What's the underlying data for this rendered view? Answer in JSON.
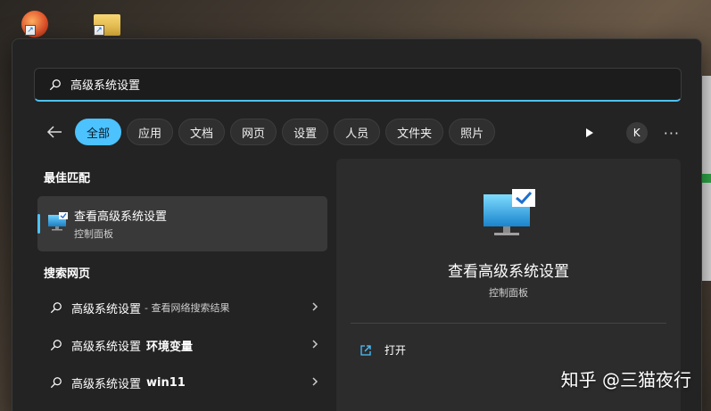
{
  "search": {
    "query": "高级系统设置"
  },
  "filters": {
    "tabs": [
      "全部",
      "应用",
      "文档",
      "网页",
      "设置",
      "人员",
      "文件夹",
      "照片"
    ],
    "avatar_letter": "K",
    "more": "···"
  },
  "best_match": {
    "heading": "最佳匹配",
    "title": "查看高级系统设置",
    "subtitle": "控制面板"
  },
  "web_search": {
    "heading": "搜索网页",
    "items": [
      {
        "main": "高级系统设置",
        "sub": "- 查看网络搜索结果",
        "bold": ""
      },
      {
        "main": "高级系统设置",
        "sub": "",
        "bold": "环境变量"
      },
      {
        "main": "高级系统设置",
        "sub": "",
        "bold": "win11"
      }
    ]
  },
  "preview": {
    "title": "查看高级系统设置",
    "subtitle": "控制面板",
    "open_label": "打开"
  },
  "watermark": "知乎 @三猫夜行",
  "colors": {
    "accent": "#4cc2ff",
    "panel": "#232323"
  }
}
